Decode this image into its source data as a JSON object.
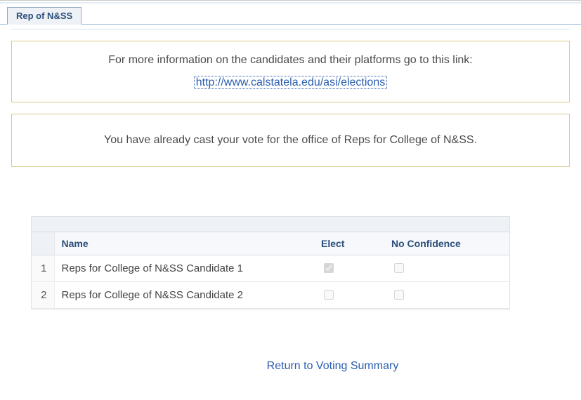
{
  "tab": {
    "label": "Rep of N&SS"
  },
  "infobox": {
    "lead": "For more information on the candidates and their platforms go to this link:",
    "link_text": "http://www.calstatela.edu/asi/elections",
    "link_href": "http://www.calstatela.edu/asi/elections"
  },
  "notice": "You have already cast your vote for the office of Reps for College of N&SS.",
  "table": {
    "header_name": "Name",
    "header_elect": "Elect",
    "header_noconf": "No Confidence",
    "rows": [
      {
        "num": "1",
        "name": "Reps for College of N&SS Candidate 1",
        "elect_checked": true,
        "noconf_checked": false
      },
      {
        "num": "2",
        "name": "Reps for College of N&SS Candidate 2",
        "elect_checked": false,
        "noconf_checked": false
      }
    ]
  },
  "return_link": "Return to Voting Summary"
}
